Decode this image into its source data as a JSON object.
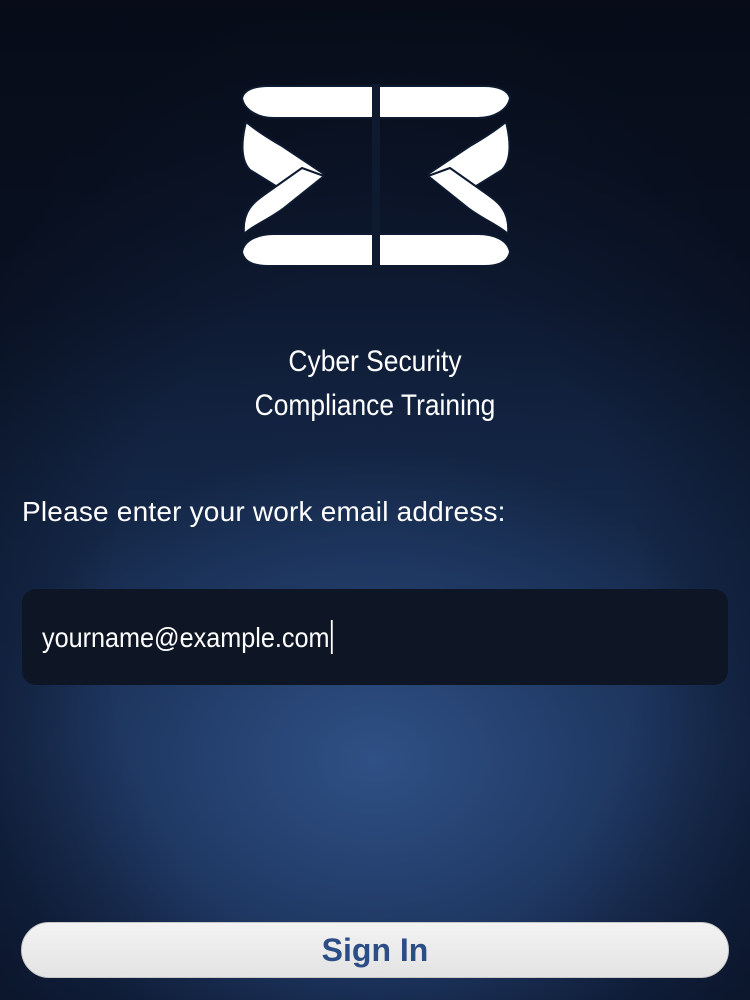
{
  "app": {
    "title_line1": "Cyber Security",
    "title_line2": "Compliance Training",
    "logo_icon": "sigma-ribbon-logo"
  },
  "login": {
    "prompt": "Please enter your work email address:",
    "email_value": "yourname@example.com",
    "sign_in_label": "Sign In"
  },
  "colors": {
    "background_dark": "#0b1426",
    "background_glow": "#2a4a7e",
    "field_background": "#0e1524",
    "button_background": "#eeeeee",
    "button_text": "#2c4e86",
    "text": "#ffffff"
  }
}
